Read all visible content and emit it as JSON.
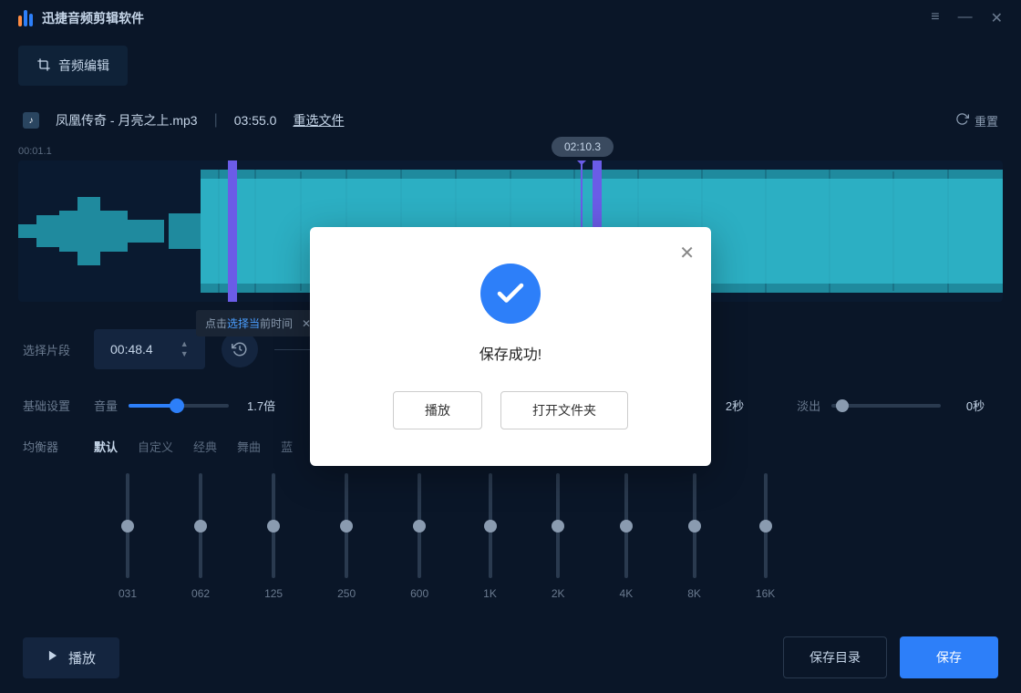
{
  "app": {
    "title": "迅捷音频剪辑软件"
  },
  "tab": {
    "label": "音频编辑"
  },
  "file": {
    "name": "凤凰传奇 - 月亮之上.mp3",
    "duration": "03:55.0",
    "reselect": "重选文件",
    "reset": "重置"
  },
  "timeline": {
    "start_hint": "00:01.1",
    "playhead": "02:10.3",
    "tooltip_pre": "点击",
    "tooltip_link": "选择当",
    "tooltip_post": "前时间"
  },
  "segment": {
    "label": "选择片段",
    "from": "00:48.4"
  },
  "basic": {
    "label": "基础设置",
    "volume_label": "音量",
    "volume_value": "1.7倍",
    "fade_in_label": "淡出",
    "fade_in_value": "2秒",
    "fade_out_label": "淡出",
    "fade_out_value": "0秒"
  },
  "eq": {
    "label": "均衡器",
    "tabs": [
      "默认",
      "自定义",
      "经典",
      "舞曲",
      "蓝"
    ],
    "bands": [
      "031",
      "062",
      "125",
      "250",
      "600",
      "1K",
      "2K",
      "4K",
      "8K",
      "16K"
    ]
  },
  "bottom": {
    "play": "播放",
    "save_dir": "保存目录",
    "save": "保存"
  },
  "modal": {
    "message": "保存成功!",
    "play": "播放",
    "open_folder": "打开文件夹"
  }
}
